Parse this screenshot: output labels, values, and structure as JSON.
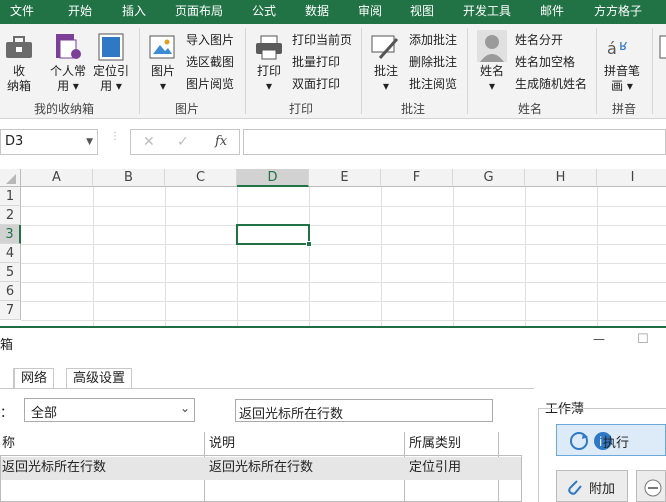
{
  "ribbon_tabs": [
    "文件",
    "开始",
    "插入",
    "页面布局",
    "公式",
    "数据",
    "审阅",
    "视图",
    "开发工具",
    "邮件",
    "方方格子"
  ],
  "ribbon": {
    "groups": {
      "my_toolbox": "我的收纳箱",
      "picture": "图片",
      "print": "打印",
      "comment": "批注",
      "name": "姓名",
      "pinyin": "拼音"
    },
    "buttons": {
      "collect": "收\n纳箱",
      "personal": "个人常\n用 ▾",
      "locate": "定位引\n用 ▾",
      "picture": "图片\n▾",
      "print": "打印\n▾",
      "comment": "批注\n▾",
      "name": "姓名\n▾",
      "pinyin": "拼音笔\n画 ▾"
    },
    "small": {
      "import_pic": "导入图片",
      "select_shot": "选区截图",
      "pic_browse": "图片阅览",
      "print_current": "打印当前页",
      "batch_print": "批量打印",
      "duplex_print": "双面打印",
      "add_comment": "添加批注",
      "delete_comment": "删除批注",
      "comment_browse": "批注阅览",
      "split_name": "姓名分开",
      "name_space": "姓名加空格",
      "random_name": "生成随机姓名"
    }
  },
  "formula": {
    "namebox": "D3",
    "cancel": "✕",
    "confirm": "✓",
    "fx": "fx",
    "value": ""
  },
  "grid": {
    "columns": [
      "A",
      "B",
      "C",
      "D",
      "E",
      "F",
      "G",
      "H",
      "I"
    ],
    "rows": [
      "1",
      "2",
      "3",
      "4",
      "5",
      "6",
      "7"
    ],
    "selected": "D3"
  },
  "dialog": {
    "title_fragment": "箱",
    "tabs": [
      "网络",
      "高级设置"
    ],
    "filter_label_fragment": "：",
    "category_value": "全部",
    "search_value": "返回光标所在行数",
    "table_headers": [
      "称",
      "说明",
      "所属类别"
    ],
    "rows": [
      {
        "name": "返回光标所在行数",
        "desc": "返回光标所在行数",
        "category": "定位引用"
      }
    ],
    "workbook_label": "工作薄",
    "run_label": "执行",
    "attach_label": "附加",
    "minimize": "—",
    "maximize": "☐"
  }
}
